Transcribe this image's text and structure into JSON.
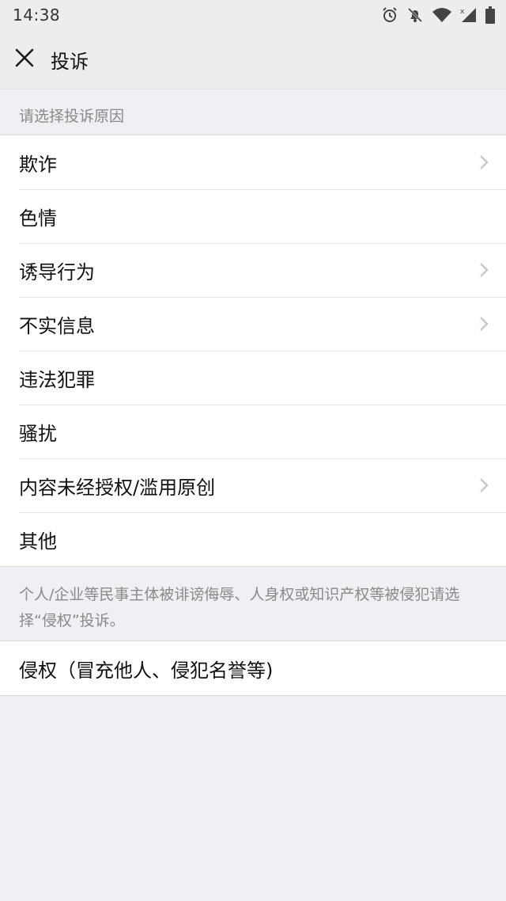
{
  "status_bar": {
    "time": "14:38",
    "icons": [
      "alarm-icon",
      "bell-off-icon",
      "wifi-icon",
      "signal-icon",
      "battery-icon"
    ]
  },
  "header": {
    "title": "投诉",
    "close_icon": "close-icon"
  },
  "section_hint": "请选择投诉原因",
  "reasons": [
    {
      "label": "欺诈",
      "has_chevron": true
    },
    {
      "label": "色情",
      "has_chevron": false
    },
    {
      "label": "诱导行为",
      "has_chevron": true
    },
    {
      "label": "不实信息",
      "has_chevron": true
    },
    {
      "label": "违法犯罪",
      "has_chevron": false
    },
    {
      "label": "骚扰",
      "has_chevron": false
    },
    {
      "label": "内容未经授权/滥用原创",
      "has_chevron": true
    },
    {
      "label": "其他",
      "has_chevron": false
    }
  ],
  "infringement_notice": "个人/企业等民事主体被诽谤侮辱、人身权或知识产权等被侵犯请选择“侵权”投诉。",
  "infringement": {
    "label": "侵权（冒充他人、侵犯名誉等)",
    "has_chevron": false
  },
  "colors": {
    "background": "#efeff4",
    "header": "#ededed",
    "row": "#ffffff",
    "hint_text": "#8a8a8a",
    "chevron": "#c7c7cc"
  }
}
